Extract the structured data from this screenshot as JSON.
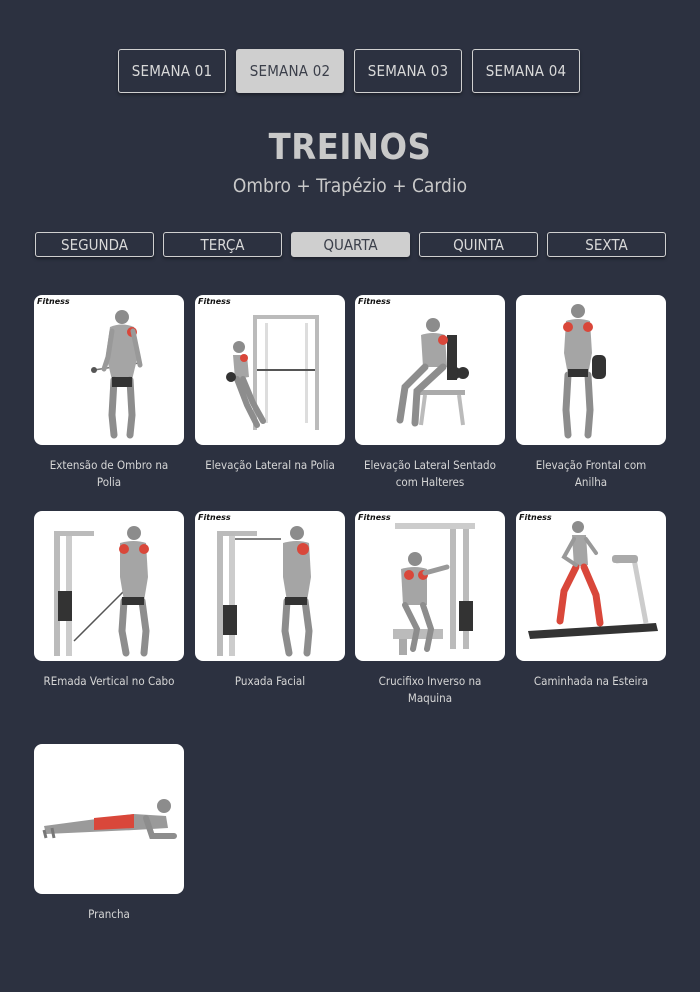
{
  "weeks": [
    {
      "label": "SEMANA 01",
      "active": false
    },
    {
      "label": "SEMANA 02",
      "active": true
    },
    {
      "label": "SEMANA 03",
      "active": false
    },
    {
      "label": "SEMANA 04",
      "active": false
    }
  ],
  "header": {
    "title": "TREINOS",
    "subtitle": "Ombro + Trapézio + Cardio"
  },
  "days": [
    {
      "label": "SEGUNDA",
      "active": false
    },
    {
      "label": "TERÇA",
      "active": false
    },
    {
      "label": "QUARTA",
      "active": true
    },
    {
      "label": "QUINTA",
      "active": false
    },
    {
      "label": "SEXTA",
      "active": false
    }
  ],
  "exercises": [
    {
      "name": "Extensão de Ombro na Polia",
      "logo": "Fitness"
    },
    {
      "name": "Elevação Lateral na Polia",
      "logo": "Fitness"
    },
    {
      "name": "Elevação Lateral Sentado com Halteres",
      "logo": "Fitness"
    },
    {
      "name": "Elevação Frontal com Anilha",
      "logo": ""
    },
    {
      "name": "REmada Vertical no Cabo",
      "logo": ""
    },
    {
      "name": "Puxada Facial",
      "logo": "Fitness"
    },
    {
      "name": "Crucifixo Inverso na Maquina",
      "logo": "Fitness"
    },
    {
      "name": "Caminhada na Esteira",
      "logo": "Fitness"
    },
    {
      "name": "Prancha",
      "logo": ""
    }
  ],
  "colors": {
    "background": "#2c3140",
    "tab_active": "#cfcfcf",
    "muscle_highlight": "#d9473a"
  }
}
